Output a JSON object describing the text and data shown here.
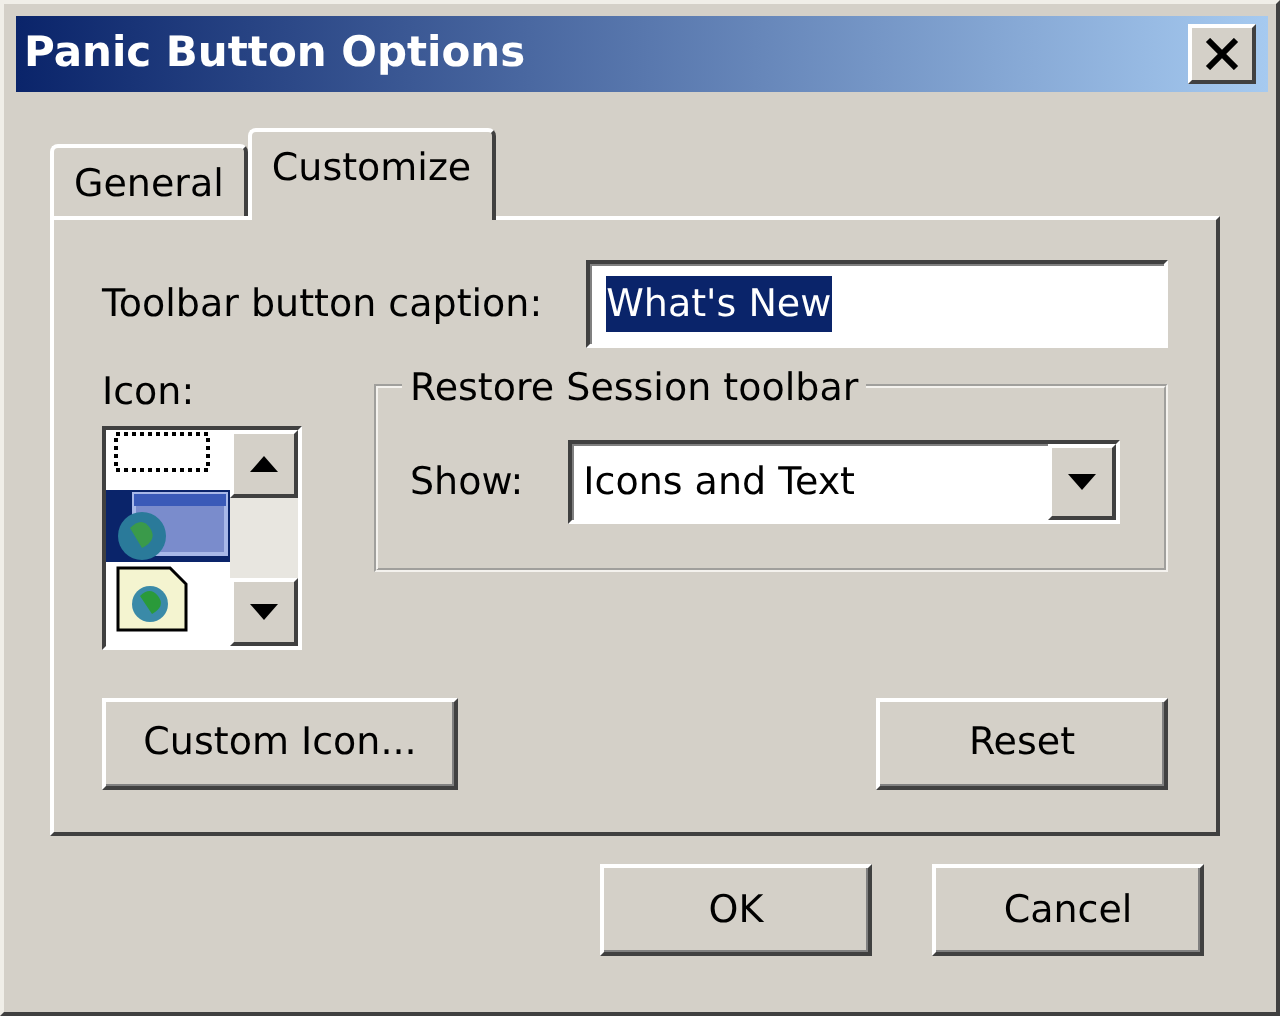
{
  "window": {
    "title": "Panic Button Options"
  },
  "tabs": [
    {
      "label": "General",
      "selected": false
    },
    {
      "label": "Customize",
      "selected": true
    }
  ],
  "caption": {
    "label": "Toolbar button caption:",
    "value": "What's New",
    "text_selected": true
  },
  "icon_list": {
    "label": "Icon:",
    "items": [
      {
        "kind": "frame",
        "selected": false
      },
      {
        "kind": "window",
        "selected": true
      },
      {
        "kind": "page",
        "selected": false
      }
    ]
  },
  "restore_group": {
    "title": "Restore Session toolbar",
    "show_label": "Show:",
    "show_value": "Icons and Text"
  },
  "panel_buttons": [
    "Custom Icon...",
    "Reset"
  ],
  "buttons": [
    "OK",
    "Cancel"
  ]
}
